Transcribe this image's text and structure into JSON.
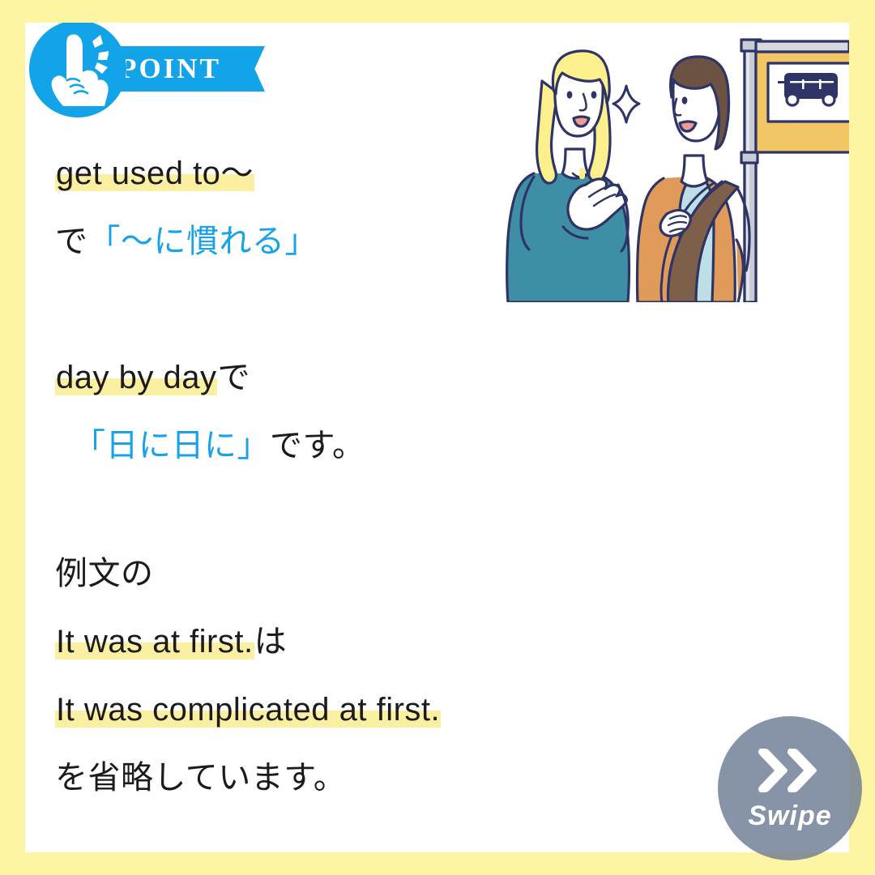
{
  "theme": {
    "page_background": "#FDF4A4",
    "card_background": "#FFFFFF",
    "accent_blue": "#13A3E8",
    "text_blue": "#18A2E8",
    "highlight_yellow": "#FBF0A2",
    "text_black": "#1B1B1B",
    "swipe_circle": "#6C7B93"
  },
  "badge": {
    "label": "POINT",
    "icon": "pointing-finger-icon"
  },
  "lines": {
    "l1_highlight": "get used to〜",
    "l2_prefix": "で",
    "l2_blue": "「〜に慣れる」",
    "l3_highlight": "day by day",
    "l3_suffix": "で",
    "l4_blue": "「日に日に」",
    "l4_suffix": "です。",
    "l5": "例文の",
    "l6_highlight": "It was at first.",
    "l6_suffix": "は",
    "l7_highlight": "It was complicated at first.",
    "l8": "を省略しています。"
  },
  "illustration": {
    "name": "two-women-talking-at-bus-stop",
    "elements": [
      "blonde-woman-teal-sweater",
      "sparkle",
      "brunette-woman-orange-jacket-brown-bag",
      "bus-stop-sign"
    ]
  },
  "swipe": {
    "label": "Swipe",
    "icon": "double-chevron-right-icon"
  }
}
